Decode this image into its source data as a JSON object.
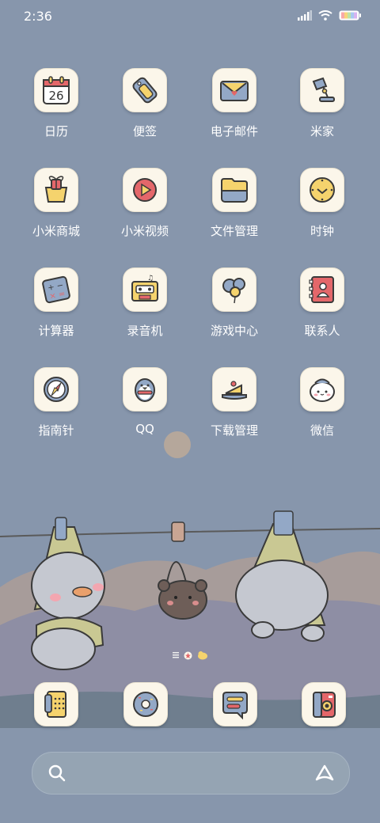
{
  "status_bar": {
    "time": "2:36"
  },
  "apps": [
    {
      "id": "calendar",
      "label": "日历",
      "icon": "calendar-icon",
      "date": "26"
    },
    {
      "id": "notes",
      "label": "便签",
      "icon": "notes-tag-icon"
    },
    {
      "id": "email",
      "label": "电子邮件",
      "icon": "email-envelope-icon"
    },
    {
      "id": "mijia",
      "label": "米家",
      "icon": "desk-lamp-icon"
    },
    {
      "id": "mi-store",
      "label": "小米商城",
      "icon": "gift-basket-icon"
    },
    {
      "id": "mi-video",
      "label": "小米视频",
      "icon": "play-icon"
    },
    {
      "id": "file-manager",
      "label": "文件管理",
      "icon": "folder-box-icon"
    },
    {
      "id": "clock",
      "label": "时钟",
      "icon": "clock-icon"
    },
    {
      "id": "calculator",
      "label": "计算器",
      "icon": "calculator-icon"
    },
    {
      "id": "recorder",
      "label": "录音机",
      "icon": "cassette-icon"
    },
    {
      "id": "game-center",
      "label": "游戏中心",
      "icon": "balloon-bear-icon"
    },
    {
      "id": "contacts",
      "label": "联系人",
      "icon": "contact-book-icon"
    },
    {
      "id": "compass",
      "label": "指南针",
      "icon": "compass-icon"
    },
    {
      "id": "qq",
      "label": "QQ",
      "icon": "penguin-icon"
    },
    {
      "id": "downloads",
      "label": "下载管理",
      "icon": "cake-slice-icon"
    },
    {
      "id": "wechat",
      "label": "微信",
      "icon": "duck-face-icon"
    }
  ],
  "dock": [
    {
      "id": "phone",
      "icon": "phone-icon"
    },
    {
      "id": "messages",
      "icon": "donut-icon"
    },
    {
      "id": "chat",
      "icon": "chat-bubble-icon"
    },
    {
      "id": "camera",
      "icon": "camera-icon"
    }
  ],
  "colors": {
    "wallpaper": "#8796ac",
    "tile": "#fbf6ea",
    "icon_yellow": "#f5d36d",
    "icon_red": "#e4676a",
    "icon_blue": "#93a8c6",
    "outline": "#3a3a3a"
  }
}
